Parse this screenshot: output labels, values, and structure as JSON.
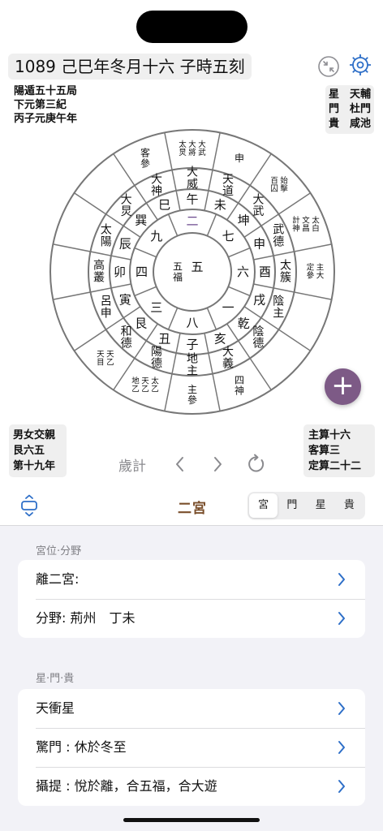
{
  "header": {
    "datetime": "1089 己巳年冬月十六 子時五刻",
    "left_info": [
      "陽遁五十五局",
      "下元第三紀",
      "丙子元庚午年"
    ],
    "right_info": [
      [
        "星",
        "天輔"
      ],
      [
        "門",
        "杜門"
      ],
      [
        "貴",
        "咸池"
      ]
    ],
    "icons": [
      "exit-fullscreen-icon",
      "settings-gear-icon"
    ]
  },
  "chart": {
    "center": [
      "五",
      "五福"
    ],
    "ring1": [
      "二",
      "七",
      "六",
      "一",
      "八",
      "三",
      "四",
      "九"
    ],
    "ring2": [
      "午",
      "未",
      "申",
      "酉",
      "戌",
      "亥",
      "子",
      "丑",
      "寅",
      "卯",
      "辰",
      "巳"
    ],
    "ring2_inner": [
      "坤",
      "乾",
      "艮",
      "巽"
    ],
    "ring3": [
      "大威",
      "天道",
      "大武",
      "武德",
      "太簇",
      "陰主",
      "陰德",
      "大義",
      "地主",
      "陽德",
      "和德",
      "呂申",
      "高叢",
      "太陽",
      "大炅",
      "大神"
    ],
    "ring4": [
      "大武 大將 太炅",
      "申",
      "始擊 百囚",
      "太白 文昌 計神",
      "主大 定參",
      "",
      "",
      "四神",
      "主參",
      "太乙 天乙 地乙",
      "天乙 天目",
      "",
      "",
      "",
      "",
      "客參"
    ],
    "highlight_color": "#6b4a8e"
  },
  "bottom_left": [
    "男女交親",
    "艮六五",
    "第十九年"
  ],
  "bottom_right": [
    "主算十六",
    "客算三",
    "定算二十二"
  ],
  "controls": {
    "label": "歲計"
  },
  "tabs": {
    "title": "二宮",
    "segments": [
      "宮",
      "門",
      "星",
      "貴"
    ],
    "active": 0
  },
  "section1": {
    "label": "宮位·分野",
    "items": [
      "離二宮:",
      "分野: 荊州　丁未"
    ]
  },
  "section2": {
    "label": "星·門·貴",
    "items": [
      "天衝星",
      "驚門 : 休於冬至",
      "攝提 : 悅於離，合五福，合大遊"
    ]
  },
  "colors": {
    "accent": "#2e6fc8",
    "fab": "#7d5a86",
    "title_brown": "#7a4f2c"
  }
}
